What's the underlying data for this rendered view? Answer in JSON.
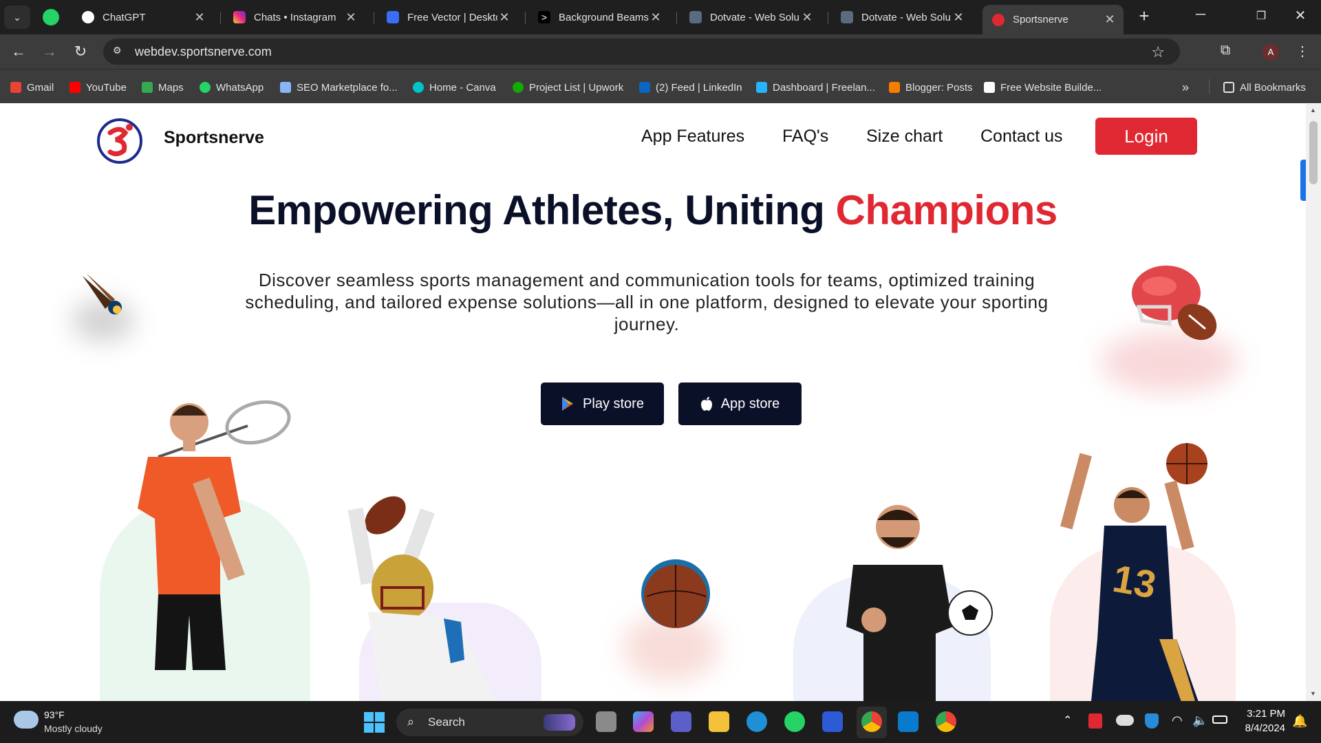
{
  "browser": {
    "tabs": [
      {
        "label": "ChatGPT",
        "color": "#ffffff"
      },
      {
        "label": "Chats • Instagram",
        "color": "#d6249f"
      },
      {
        "label": "Free Vector | Desktop",
        "color": "#3b6ef5"
      },
      {
        "label": "Background Beams",
        "color": "#111111"
      },
      {
        "label": "Dotvate - Web Solu",
        "color": "#5a6b80"
      },
      {
        "label": "Dotvate - Web Solu",
        "color": "#5a6b80"
      },
      {
        "label": "Sportsnerve",
        "color": "#e02832"
      }
    ],
    "url": "webdev.sportsnerve.com",
    "bookmarks": [
      {
        "label": "Gmail",
        "color": "#ea4335"
      },
      {
        "label": "YouTube",
        "color": "#ff0000"
      },
      {
        "label": "Maps",
        "color": "#34a853"
      },
      {
        "label": "WhatsApp",
        "color": "#25d366"
      },
      {
        "label": "SEO Marketplace fo...",
        "color": "#8ab4f8"
      },
      {
        "label": "Home - Canva",
        "color": "#00c4cc"
      },
      {
        "label": "Project List | Upwork",
        "color": "#14a800"
      },
      {
        "label": "(2) Feed | LinkedIn",
        "color": "#0a66c2"
      },
      {
        "label": "Dashboard | Freelan...",
        "color": "#29b2fe"
      },
      {
        "label": "Blogger: Posts",
        "color": "#f57d00"
      },
      {
        "label": "Free Website Builde...",
        "color": "#ffffff"
      }
    ],
    "all_bookmarks": "All Bookmarks",
    "profile_initial": "A"
  },
  "site": {
    "brand": "Sportsnerve",
    "nav": [
      "App Features",
      "FAQ's",
      "Size chart",
      "Contact us"
    ],
    "login": "Login",
    "hero_title_main": "Empowering Athletes, Uniting ",
    "hero_title_highlight": "Champions",
    "hero_subtitle": "Discover seamless sports management and communication tools for teams, optimized training scheduling, and tailored expense solutions—all in one platform, designed to elevate your sporting journey.",
    "play_store": "Play store",
    "app_store": "App store",
    "jersey_number": "13",
    "accent_color": "#e02832",
    "dark_color": "#0b1029"
  },
  "taskbar": {
    "weather_temp": "93°F",
    "weather_desc": "Mostly cloudy",
    "search_placeholder": "Search",
    "time": "3:21 PM",
    "date": "8/4/2024"
  }
}
